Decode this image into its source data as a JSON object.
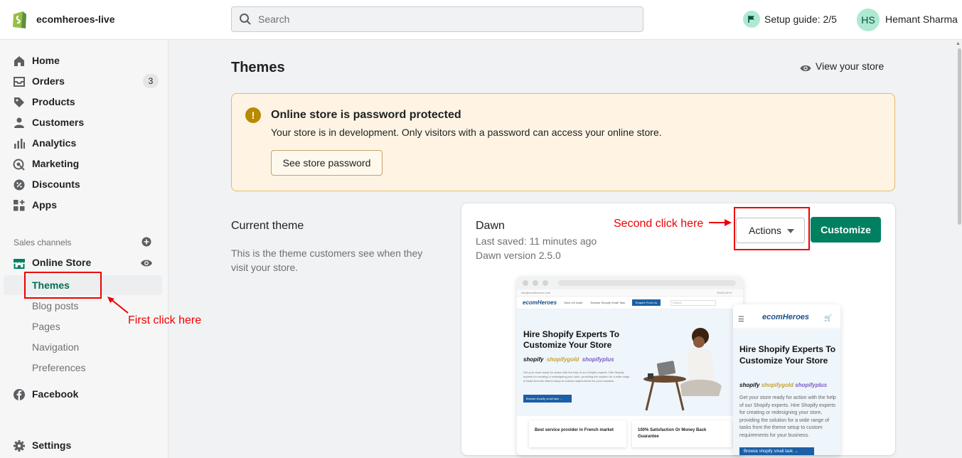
{
  "topbar": {
    "store_name": "ecomheroes-live",
    "search_placeholder": "Search",
    "setup_guide": "Setup guide: 2/5",
    "avatar_initials": "HS",
    "user_name": "Hemant Sharma"
  },
  "sidebar": {
    "items": [
      {
        "label": "Home",
        "icon": "home-icon"
      },
      {
        "label": "Orders",
        "icon": "orders-icon",
        "badge": "3"
      },
      {
        "label": "Products",
        "icon": "tag-icon"
      },
      {
        "label": "Customers",
        "icon": "person-icon"
      },
      {
        "label": "Analytics",
        "icon": "analytics-icon"
      },
      {
        "label": "Marketing",
        "icon": "marketing-icon"
      },
      {
        "label": "Discounts",
        "icon": "discount-icon"
      },
      {
        "label": "Apps",
        "icon": "apps-icon"
      }
    ],
    "sales_channels_label": "Sales channels",
    "online_store": "Online Store",
    "online_store_sub": [
      "Themes",
      "Blog posts",
      "Pages",
      "Navigation",
      "Preferences"
    ],
    "facebook": "Facebook",
    "settings": "Settings"
  },
  "main": {
    "title": "Themes",
    "view_store": "View your store",
    "banner": {
      "title": "Online store is password protected",
      "message": "Your store is in development. Only visitors with a password can access your online store.",
      "button": "See store password"
    },
    "current_theme": {
      "heading": "Current theme",
      "description": "This is the theme customers see when they visit your store.",
      "name": "Dawn",
      "last_saved": "Last saved: 11 minutes ago",
      "version": "Dawn version 2.5.0",
      "actions_label": "Actions",
      "customize_label": "Customize"
    }
  },
  "annotations": {
    "first": "First click here",
    "second": "Second click here"
  },
  "preview": {
    "brand": "ecomHeroes",
    "topline": "info@ecomheroes.com",
    "currency": "ENGLISH ▾",
    "nav_links": [
      "Store UX Audit",
      "Browse Shopify Small Task"
    ],
    "cta": "Enquire From Us",
    "search": "Search",
    "headline": "Hire Shopify Experts To Customize Your Store",
    "logo_shopify": "shopify",
    "logo_gold": "shopifygold",
    "logo_plus": "shopifyplus",
    "desktop_para": "Get your store ready for action with the help of our Shopify experts. Hire Shopify experts for creating or redesigning your store, providing the solution for a wide range of tasks from the theme setup to custom requirements for your business.",
    "button": "Browse shopify small task  →",
    "service_1": "Best service provider in French market",
    "service_2": "100% Satisfaction Or Money Back Guarantee",
    "mobile_para": "Get your store ready for action with the help of our Shopify experts. Hire Shopify experts for creating or redesigning your store, providing the solution for a wide range of tasks from the theme setup to custom requirements for your business."
  },
  "colors": {
    "primary_green": "#008060",
    "active_text": "#006e52",
    "banner_bg": "#fff4e4",
    "warning": "#b98900",
    "annotation_red": "#ee0000"
  }
}
